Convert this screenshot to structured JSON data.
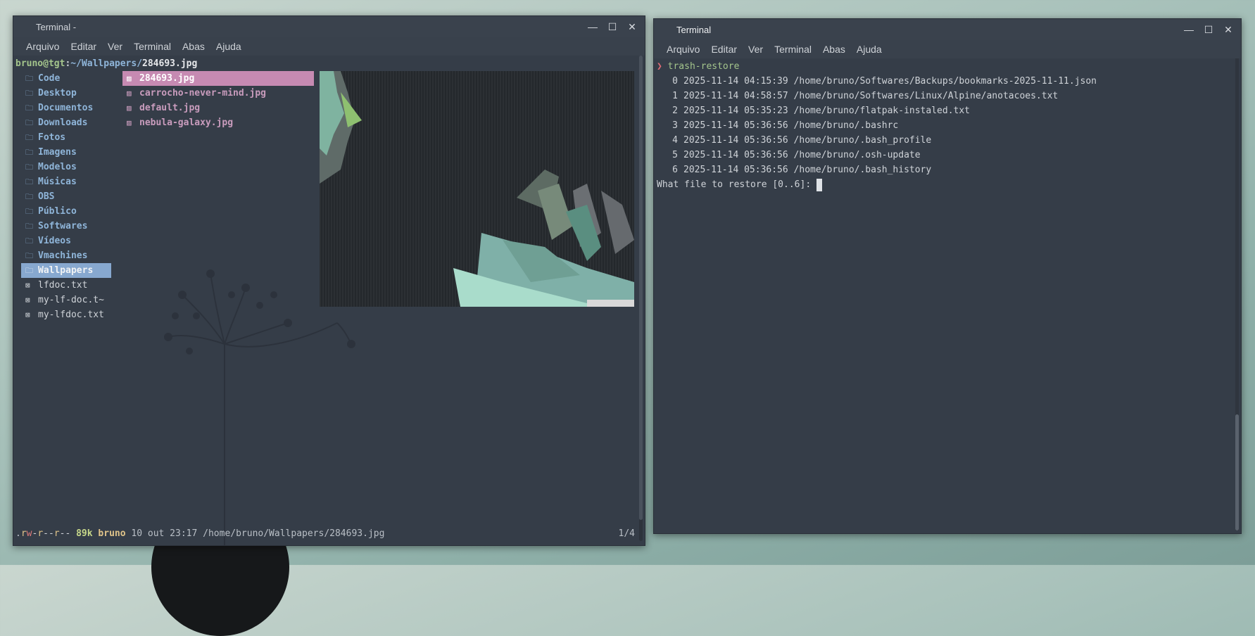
{
  "left_window": {
    "title": "Terminal -",
    "menu": [
      "Arquivo",
      "Editar",
      "Ver",
      "Terminal",
      "Abas",
      "Ajuda"
    ],
    "path": {
      "user_host": "bruno@tgt",
      "sep": ":",
      "dir": "~/Wallpapers/",
      "file": "284693.jpg"
    },
    "dirs": [
      {
        "icon": "🗀",
        "label": "Code"
      },
      {
        "icon": "🗀",
        "label": "Desktop"
      },
      {
        "icon": "🗀",
        "label": "Documentos"
      },
      {
        "icon": "🗀",
        "label": "Downloads"
      },
      {
        "icon": "🗀",
        "label": "Fotos"
      },
      {
        "icon": "🗀",
        "label": "Imagens"
      },
      {
        "icon": "🗀",
        "label": "Modelos"
      },
      {
        "icon": "🗀",
        "label": "Músicas"
      },
      {
        "icon": "🗀",
        "label": "OBS"
      },
      {
        "icon": "🗀",
        "label": "Público"
      },
      {
        "icon": "🗀",
        "label": "Softwares"
      },
      {
        "icon": "🗀",
        "label": "Vídeos"
      },
      {
        "icon": "🗀",
        "label": "Vmachines"
      },
      {
        "icon": "🗀",
        "label": "Wallpapers"
      },
      {
        "icon": "⊠",
        "label": "lfdoc.txt"
      },
      {
        "icon": "⊠",
        "label": "my-lf-doc.t~"
      },
      {
        "icon": "⊠",
        "label": "my-lfdoc.txt"
      }
    ],
    "files": [
      {
        "icon": "▨",
        "label": "284693.jpg"
      },
      {
        "icon": "▨",
        "label": "carrocho-never-mind.jpg"
      },
      {
        "icon": "▨",
        "label": "default.jpg"
      },
      {
        "icon": "▨",
        "label": "nebula-galaxy.jpg"
      }
    ],
    "status": {
      "perm_dot": ".",
      "perm_r1": "r",
      "perm_w": "w",
      "perm_x1": "-",
      "perm_r2": "r",
      "perm_x2": "--",
      "perm_r3": "r",
      "perm_x3": "--",
      "size": "89k",
      "owner": "bruno",
      "date": "10 out 23:17",
      "fullpath": "/home/bruno/Wallpapers/284693.jpg",
      "position": "1/4"
    }
  },
  "right_window": {
    "title": "Terminal",
    "menu": [
      "Arquivo",
      "Editar",
      "Ver",
      "Terminal",
      "Abas",
      "Ajuda"
    ],
    "prompt_symbol": "❯",
    "command": "trash-restore",
    "entries": [
      {
        "idx": "0",
        "datetime": "2025-11-14 04:15:39",
        "path": "/home/bruno/Softwares/Backups/bookmarks-2025-11-11.json"
      },
      {
        "idx": "1",
        "datetime": "2025-11-14 04:58:57",
        "path": "/home/bruno/Softwares/Linux/Alpine/anotacoes.txt"
      },
      {
        "idx": "2",
        "datetime": "2025-11-14 05:35:23",
        "path": "/home/bruno/flatpak-instaled.txt"
      },
      {
        "idx": "3",
        "datetime": "2025-11-14 05:36:56",
        "path": "/home/bruno/.bashrc"
      },
      {
        "idx": "4",
        "datetime": "2025-11-14 05:36:56",
        "path": "/home/bruno/.bash_profile"
      },
      {
        "idx": "5",
        "datetime": "2025-11-14 05:36:56",
        "path": "/home/bruno/.osh-update"
      },
      {
        "idx": "6",
        "datetime": "2025-11-14 05:36:56",
        "path": "/home/bruno/.bash_history"
      }
    ],
    "question": "What file to restore [0..6]: "
  },
  "window_buttons": {
    "minimize": "—",
    "maximize": "☐",
    "close": "✕"
  }
}
